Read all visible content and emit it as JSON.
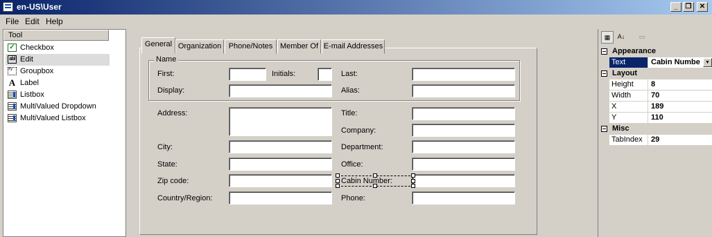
{
  "window": {
    "title": "en-US\\User",
    "btn_minimize": "_",
    "btn_restore": "❐",
    "btn_close": "✕"
  },
  "menu": {
    "file": "File",
    "edit": "Edit",
    "help": "Help"
  },
  "toolbox": {
    "header": "Tool",
    "items": [
      {
        "label": "Checkbox",
        "icon": "checkbox-icon",
        "glyph": "✓"
      },
      {
        "label": "Edit",
        "icon": "edit-icon",
        "glyph": "abl"
      },
      {
        "label": "Groupbox",
        "icon": "groupbox-icon",
        "glyph": "xy"
      },
      {
        "label": "Label",
        "icon": "label-icon",
        "glyph": "A"
      },
      {
        "label": "Listbox",
        "icon": "listbox-icon",
        "glyph": ""
      },
      {
        "label": "MultiValued Dropdown",
        "icon": "multivalued-dropdown-icon",
        "glyph": ""
      },
      {
        "label": "MultiValued Listbox",
        "icon": "multivalued-listbox-icon",
        "glyph": ""
      }
    ],
    "selected_index": 1
  },
  "tabs": [
    "General",
    "Organization",
    "Phone/Notes",
    "Member Of",
    "E-mail Addresses"
  ],
  "form": {
    "group_name": "Name",
    "first": "First:",
    "initials": "Initials:",
    "last": "Last:",
    "display": "Display:",
    "alias": "Alias:",
    "address": "Address:",
    "title": "Title:",
    "company": "Company:",
    "city": "City:",
    "department": "Department:",
    "state": "State:",
    "office": "Office:",
    "zip": "Zip code:",
    "cabin": "Cabin Number:",
    "country": "Country/Region:",
    "phone": "Phone:"
  },
  "propgrid": {
    "categorized_glyph": "▦",
    "alpha_glyph": "A↓",
    "pages_glyph": "▭",
    "categories": {
      "appearance": "Appearance",
      "layout": "Layout",
      "misc": "Misc"
    },
    "rows": {
      "text_name": "Text",
      "text_value": "Cabin Numbe",
      "height_name": "Height",
      "height_value": "8",
      "width_name": "Width",
      "width_value": "70",
      "x_name": "X",
      "x_value": "189",
      "y_name": "Y",
      "y_value": "110",
      "tabindex_name": "TabIndex",
      "tabindex_value": "29"
    },
    "dropdown_glyph": "▼"
  },
  "colors": {
    "titlebar_start": "#0a246a",
    "titlebar_end": "#a6caf0",
    "selection": "#0a246a",
    "face": "#d4d0c8"
  }
}
